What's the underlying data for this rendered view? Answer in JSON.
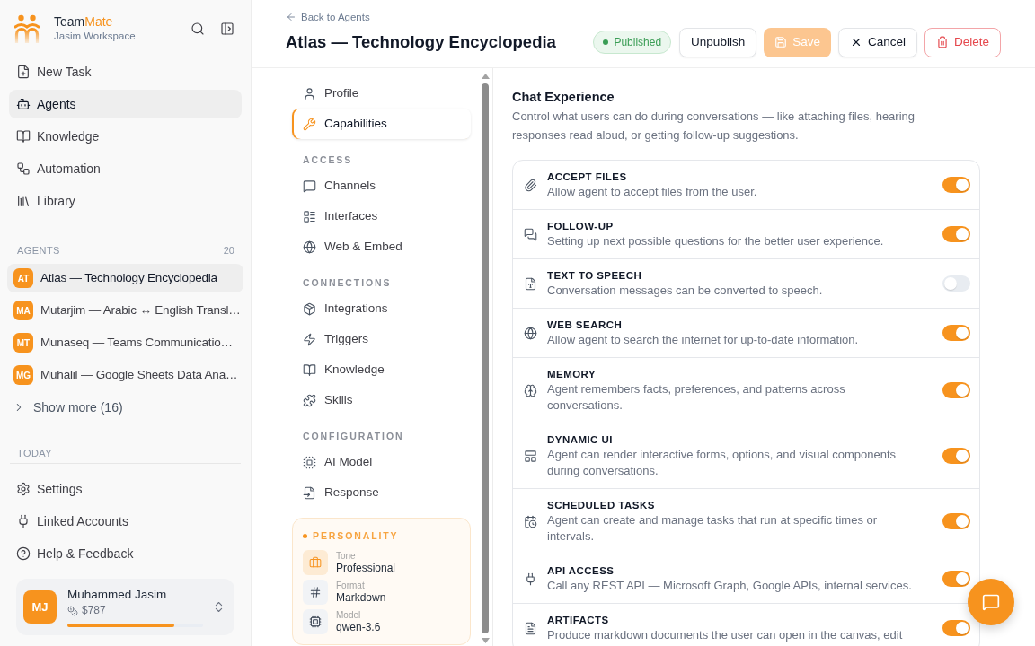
{
  "sidebar": {
    "brand": {
      "name_start": "Team",
      "name_end": "Mate",
      "workspace": "Jasim Workspace"
    },
    "nav": [
      {
        "label": "New Task",
        "selected": false
      },
      {
        "label": "Agents",
        "selected": true
      },
      {
        "label": "Knowledge",
        "selected": false
      },
      {
        "label": "Automation",
        "selected": false
      },
      {
        "label": "Library",
        "selected": false
      }
    ],
    "agents": {
      "title": "AGENTS",
      "count": "20",
      "items": [
        {
          "initials": "AT",
          "name": "Atlas — Technology Encyclopedia",
          "selected": true
        },
        {
          "initials": "MA",
          "name": "Mutarjim — Arabic ↔ English Transl…",
          "selected": false
        },
        {
          "initials": "MT",
          "name": "Munaseq — Teams Communicatio…",
          "selected": false
        },
        {
          "initials": "MG",
          "name": "Muhalil — Google Sheets Data Ana…",
          "selected": false
        }
      ],
      "show_more": "Show more (16)"
    },
    "today": {
      "title": "TODAY"
    },
    "footer_nav": [
      {
        "label": "Settings"
      },
      {
        "label": "Linked Accounts"
      },
      {
        "label": "Help & Feedback"
      }
    ],
    "account": {
      "initials": "MJ",
      "name": "Muhammed Jasim",
      "credits": "$787",
      "level": 0.79
    }
  },
  "header": {
    "back_link": "Back to Agents",
    "title": "Atlas — Technology Encyclopedia",
    "status": "Published",
    "actions": [
      {
        "label": "Unpublish",
        "kind": "outline",
        "disabled": false
      },
      {
        "label": "Save",
        "kind": "primary",
        "disabled": true
      },
      {
        "label": "Cancel",
        "kind": "outline",
        "disabled": false
      },
      {
        "label": "Delete",
        "kind": "danger",
        "disabled": false
      }
    ]
  },
  "settings_nav": {
    "sections": [
      {
        "items": [
          {
            "label": "Profile",
            "selected": false
          },
          {
            "label": "Capabilities",
            "selected": true
          }
        ]
      },
      {
        "title": "ACCESS",
        "items": [
          {
            "label": "Channels",
            "selected": false
          },
          {
            "label": "Interfaces",
            "selected": false
          },
          {
            "label": "Web & Embed",
            "selected": false
          }
        ]
      },
      {
        "title": "CONNECTIONS",
        "items": [
          {
            "label": "Integrations",
            "selected": false
          },
          {
            "label": "Triggers",
            "selected": false
          },
          {
            "label": "Knowledge",
            "selected": false
          },
          {
            "label": "Skills",
            "selected": false
          }
        ]
      },
      {
        "title": "CONFIGURATION",
        "items": [
          {
            "label": "AI Model",
            "selected": false
          },
          {
            "label": "Response",
            "selected": false
          }
        ]
      }
    ]
  },
  "personality": {
    "title": "PERSONALITY",
    "items": [
      {
        "label": "Tone",
        "value": "Professional",
        "highlighted": true
      },
      {
        "label": "Format",
        "value": "Markdown",
        "highlighted": false
      },
      {
        "label": "Model",
        "value": "qwen-3.6",
        "highlighted": false
      }
    ]
  },
  "capabilities": {
    "title": "Chat Experience",
    "description": "Control what users can do during conversations — like attaching files, hearing responses read aloud, or getting follow-up suggestions.",
    "items": [
      {
        "title": "ACCEPT FILES",
        "description": "Allow agent to accept files from the user.",
        "on": true
      },
      {
        "title": "FOLLOW-UP",
        "description": "Setting up next possible questions for the better user experience.",
        "on": true
      },
      {
        "title": "TEXT TO SPEECH",
        "description": "Conversation messages can be converted to speech.",
        "on": false
      },
      {
        "title": "WEB SEARCH",
        "description": "Allow agent to search the internet for up-to-date information.",
        "on": true
      },
      {
        "title": "MEMORY",
        "description": "Agent remembers facts, preferences, and patterns across conversations.",
        "on": true
      },
      {
        "title": "DYNAMIC UI",
        "description": "Agent can render interactive forms, options, and visual components during conversations.",
        "on": true
      },
      {
        "title": "SCHEDULED TASKS",
        "description": "Agent can create and manage tasks that run at specific times or intervals.",
        "on": true
      },
      {
        "title": "API ACCESS",
        "description": "Call any REST API — Microsoft Graph, Google APIs, internal services.",
        "on": true
      },
      {
        "title": "ARTIFACTS",
        "description": "Produce markdown documents the user can open in the canvas, edit",
        "on": true
      }
    ]
  }
}
